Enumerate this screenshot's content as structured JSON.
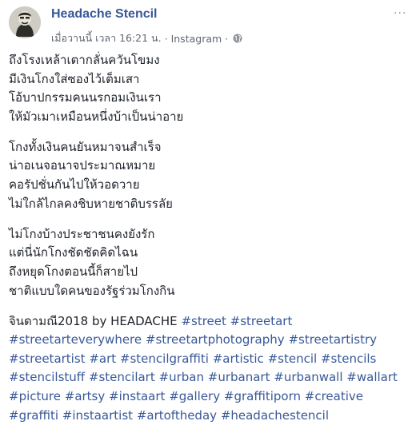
{
  "post": {
    "page_name": "Headache Stencil",
    "timestamp": "เมื่อวานนี้ เวลา 16:21 น.",
    "separator": "·",
    "source": "Instagram",
    "more_glyph": "···",
    "stanzas": [
      [
        "ถึงโรงเหล้าเตากลั่นควันโขมง",
        "มีเงินโกงใส่ซองไว้เต็มเสา",
        "โอ้บาปกรรมคนนรกอมเงินเรา",
        "ให้มัวเมาเหมือนหนึ่งบ้าเป็นน่าอาย"
      ],
      [
        "โกงทั้งเงินคนยันหมาจนสำเร็จ",
        "น่าอเนจอนาจประมาณหมาย",
        "คอรัปชั่นกันไปให้วอดวาย",
        "ไม่ใกล้ไกลคงชิบหายชาติบรรลัย"
      ],
      [
        "ไม่โกงบ้างประชาชนคงยังรัก",
        "แต่นี่นักโกงชัดชัดคิดไฉน",
        "ถึงหยุดโกงตอนนี้ก็สายไป",
        "ชาติแบบใดคนของรัฐร่วมโกงกิน"
      ]
    ],
    "caption_text": "จินดามณี2018 by HEADACHE",
    "hashtags": [
      "#street",
      "#streetart",
      "#streetarteverywhere",
      "#streetartphotography",
      "#streetartistry",
      "#streetartist",
      "#art",
      "#stencilgraffiti",
      "#artistic",
      "#stencil",
      "#stencils",
      "#stencilstuff",
      "#stencilart",
      "#urban",
      "#urbanart",
      "#urbanwall",
      "#wallart",
      "#picture",
      "#artsy",
      "#instaart",
      "#gallery",
      "#graffitiporn",
      "#creative",
      "#graffiti",
      "#instaartist",
      "#artoftheday",
      "#headachestencil"
    ]
  },
  "colors": {
    "link": "#385898",
    "text": "#1d2129",
    "meta": "#616770"
  },
  "icons": {
    "avatar": "avatar-portrait",
    "privacy": "globe-icon",
    "menu": "more-options-icon"
  }
}
